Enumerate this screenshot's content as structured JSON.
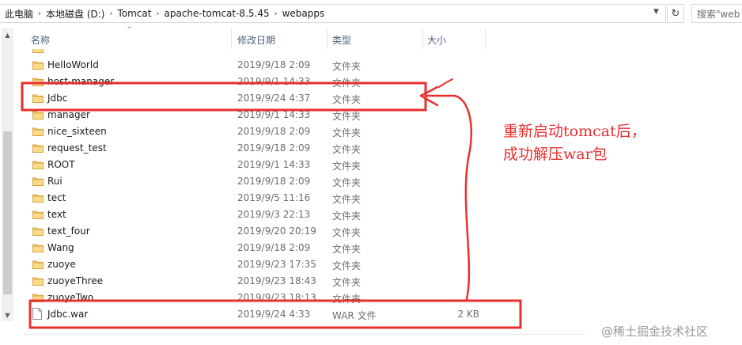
{
  "breadcrumb": [
    "此电脑",
    "本地磁盘 (D:)",
    "Tomcat",
    "apache-tomcat-8.5.45",
    "webapps"
  ],
  "search": {
    "placeholder": "搜索\"web"
  },
  "columns": {
    "name": "名称",
    "date": "修改日期",
    "type": "类型",
    "size": "大小"
  },
  "files": [
    {
      "name": "",
      "date": "",
      "type": "",
      "size": "",
      "kind": "folder",
      "partial": true
    },
    {
      "name": "HelloWorld",
      "date": "2019/9/18 2:09",
      "type": "文件夹",
      "size": "",
      "kind": "folder"
    },
    {
      "name": "host-manager",
      "date": "2019/9/1 14:33",
      "type": "文件夹",
      "size": "",
      "kind": "folder"
    },
    {
      "name": "Jdbc",
      "date": "2019/9/24 4:37",
      "type": "文件夹",
      "size": "",
      "kind": "folder"
    },
    {
      "name": "manager",
      "date": "2019/9/1 14:33",
      "type": "文件夹",
      "size": "",
      "kind": "folder"
    },
    {
      "name": "nice_sixteen",
      "date": "2019/9/18 2:09",
      "type": "文件夹",
      "size": "",
      "kind": "folder"
    },
    {
      "name": "request_test",
      "date": "2019/9/18 2:09",
      "type": "文件夹",
      "size": "",
      "kind": "folder"
    },
    {
      "name": "ROOT",
      "date": "2019/9/1 14:33",
      "type": "文件夹",
      "size": "",
      "kind": "folder"
    },
    {
      "name": "Rui",
      "date": "2019/9/18 2:09",
      "type": "文件夹",
      "size": "",
      "kind": "folder"
    },
    {
      "name": "tect",
      "date": "2019/9/5 11:16",
      "type": "文件夹",
      "size": "",
      "kind": "folder"
    },
    {
      "name": "text",
      "date": "2019/9/3 22:13",
      "type": "文件夹",
      "size": "",
      "kind": "folder"
    },
    {
      "name": "text_four",
      "date": "2019/9/20 20:19",
      "type": "文件夹",
      "size": "",
      "kind": "folder"
    },
    {
      "name": "Wang",
      "date": "2019/9/18 2:09",
      "type": "文件夹",
      "size": "",
      "kind": "folder"
    },
    {
      "name": "zuoye",
      "date": "2019/9/23 17:35",
      "type": "文件夹",
      "size": "",
      "kind": "folder"
    },
    {
      "name": "zuoyeThree",
      "date": "2019/9/23 18:43",
      "type": "文件夹",
      "size": "",
      "kind": "folder"
    },
    {
      "name": "zuoyeTwo",
      "date": "2019/9/23 18:13",
      "type": "文件夹",
      "size": "",
      "kind": "folder"
    },
    {
      "name": "Jdbc.war",
      "date": "2019/9/24 4:33",
      "type": "WAR 文件",
      "size": "2 KB",
      "kind": "file"
    }
  ],
  "annotation": {
    "line1": "重新启动tomcat后，",
    "line2": "成功解压war包"
  },
  "watermark": "@稀土掘金技术社区",
  "colors": {
    "annotation": "#e8302f",
    "folder": "#e8b84a",
    "header_text": "#4c607a"
  },
  "icons": {
    "folder": "folder-icon",
    "file": "file-icon",
    "refresh": "refresh-icon",
    "dropdown": "chevron-down-icon"
  }
}
